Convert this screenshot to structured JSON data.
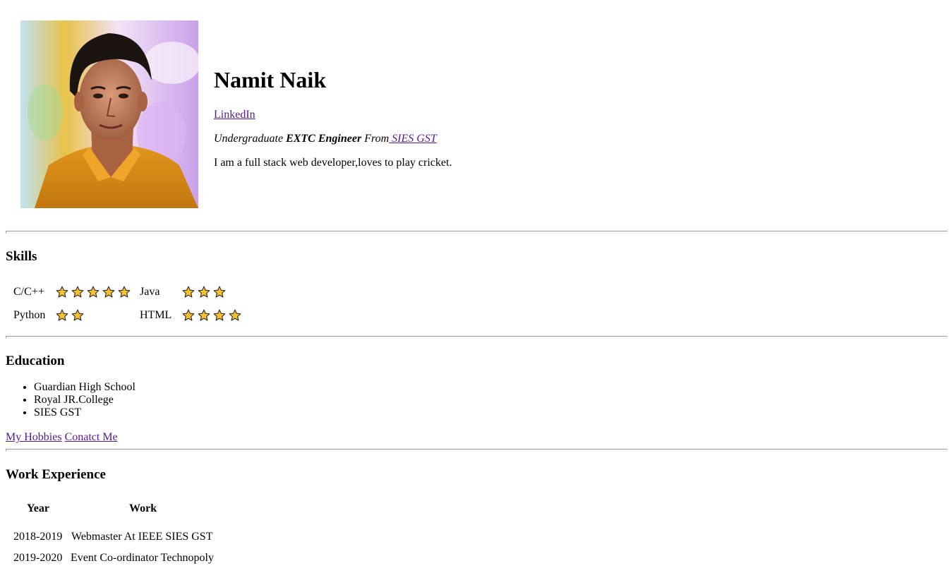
{
  "profile": {
    "name": "Namit Naik",
    "linkedin_label": "LinkedIn",
    "tagline_prefix": "Undergraduate ",
    "tagline_bold": "EXTC Engineer",
    "tagline_from": " From",
    "college_link": " SIES GST",
    "bio": "I am a full stack web developer,loves to play cricket."
  },
  "skills": {
    "heading": "Skills",
    "items": [
      {
        "label": "C/C++",
        "rating": 5
      },
      {
        "label": "Java",
        "rating": 3
      },
      {
        "label": "Python",
        "rating": 2
      },
      {
        "label": "HTML",
        "rating": 4
      }
    ]
  },
  "education": {
    "heading": "Education",
    "items": [
      "Guardian High School",
      "Royal JR.College",
      "SIES GST"
    ]
  },
  "links": {
    "hobbies": "My Hobbies",
    "contact": "Conatct Me"
  },
  "work": {
    "heading": "Work Experience",
    "col_year": "Year",
    "col_work": "Work",
    "rows": [
      {
        "year": "2018-2019",
        "work": "Webmaster At IEEE SIES GST"
      },
      {
        "year": "2019-2020",
        "work": "Event Co-ordinator Technopoly"
      }
    ]
  },
  "colors": {
    "link": "#551a8b",
    "star_fill": "#f7c12e",
    "star_stroke": "#222222"
  }
}
